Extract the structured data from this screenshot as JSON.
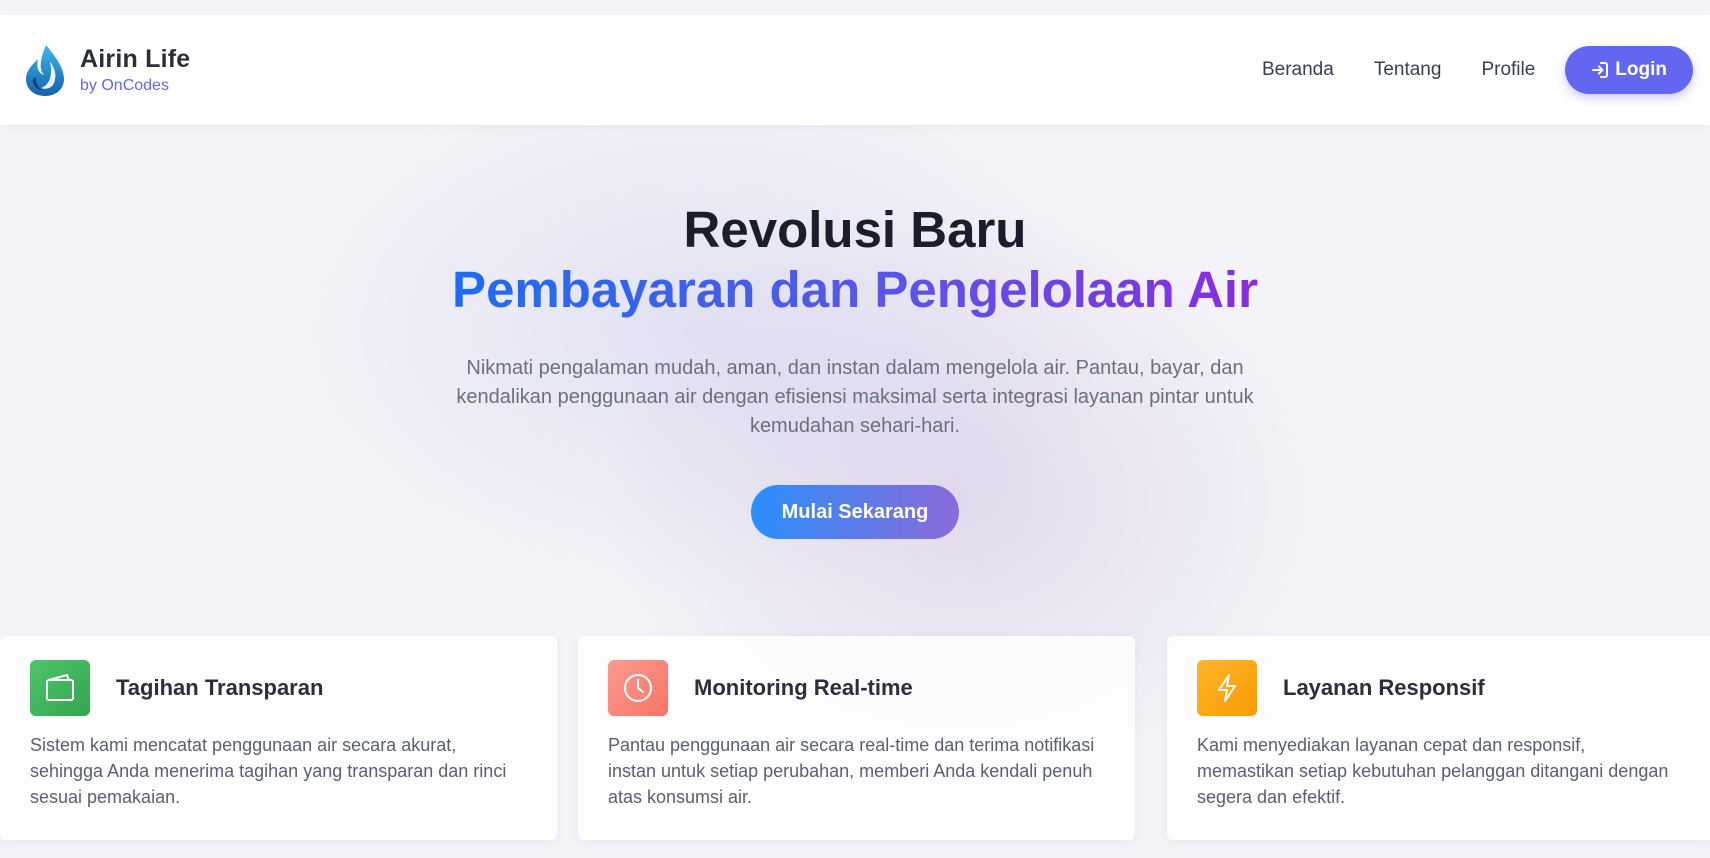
{
  "brand": {
    "name": "Airin Life",
    "subtitle": "by OnCodes",
    "logo_icon": "water-drop-icon"
  },
  "nav": {
    "links": [
      "Beranda",
      "Tentang",
      "Profile"
    ],
    "login_label": "Login",
    "login_icon": "login-arrow-icon"
  },
  "hero": {
    "title": "Revolusi Baru",
    "subtitle": "Pembayaran dan Pengelolaan Air",
    "description": "Nikmati pengalaman mudah, aman, dan instan dalam mengelola air. Pantau, bayar, dan kendalikan penggunaan air dengan efisiensi maksimal serta integrasi layanan pintar untuk kemudahan sehari-hari.",
    "cta_label": "Mulai Sekarang"
  },
  "features": [
    {
      "icon": "wallet-icon",
      "title": "Tagihan Transparan",
      "description": "Sistem kami mencatat penggunaan air secara akurat, sehingga Anda menerima tagihan yang transparan dan rinci sesuai pemakaian.",
      "color": "#43b863"
    },
    {
      "icon": "clock-icon",
      "title": "Monitoring Real-time",
      "description": "Pantau penggunaan air secara real-time dan terima notifikasi instan untuk setiap perubahan, memberi Anda kendali penuh atas konsumsi air.",
      "color": "#fa8b82"
    },
    {
      "icon": "lightning-icon",
      "title": "Layanan Responsif",
      "description": "Kami menyediakan layanan cepat dan responsif, memastikan setiap kebutuhan pelanggan ditangani dengan segera dan efektif.",
      "color": "#fca50f"
    }
  ],
  "colors": {
    "accent": "#6366f1",
    "title": "#1a1d2b"
  }
}
